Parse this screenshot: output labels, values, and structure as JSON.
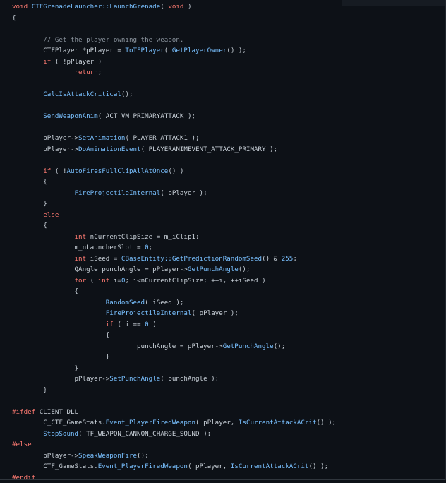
{
  "colors": {
    "background": "#0d1117",
    "keyword": "#ff7b72",
    "function": "#79c0ff",
    "comment": "#8b949e",
    "text": "#c9d1d9"
  },
  "code": {
    "language": "cpp",
    "lines": [
      [
        [
          "kw",
          "void"
        ],
        [
          "tx",
          " "
        ],
        [
          "fn",
          "CTFGrenadeLauncher::LaunchGrenade"
        ],
        [
          "tx",
          "( "
        ],
        [
          "kw",
          "void"
        ],
        [
          "tx",
          " )"
        ]
      ],
      [
        [
          "tx",
          "{"
        ]
      ],
      [],
      [
        [
          "tx",
          "\t"
        ],
        [
          "cm",
          "// Get the player owning the weapon."
        ]
      ],
      [
        [
          "tx",
          "\tCTFPlayer *pPlayer = "
        ],
        [
          "fn",
          "ToTFPlayer"
        ],
        [
          "tx",
          "( "
        ],
        [
          "fn",
          "GetPlayerOwner"
        ],
        [
          "tx",
          "() );"
        ]
      ],
      [
        [
          "tx",
          "\t"
        ],
        [
          "kw",
          "if"
        ],
        [
          "tx",
          " ( !pPlayer )"
        ]
      ],
      [
        [
          "tx",
          "\t\t"
        ],
        [
          "kw",
          "return"
        ],
        [
          "tx",
          ";"
        ]
      ],
      [],
      [
        [
          "tx",
          "\t"
        ],
        [
          "fn",
          "CalcIsAttackCritical"
        ],
        [
          "tx",
          "();"
        ]
      ],
      [],
      [
        [
          "tx",
          "\t"
        ],
        [
          "fn",
          "SendWeaponAnim"
        ],
        [
          "tx",
          "( ACT_VM_PRIMARYATTACK );"
        ]
      ],
      [],
      [
        [
          "tx",
          "\tpPlayer->"
        ],
        [
          "fn",
          "SetAnimation"
        ],
        [
          "tx",
          "( PLAYER_ATTACK1 );"
        ]
      ],
      [
        [
          "tx",
          "\tpPlayer->"
        ],
        [
          "fn",
          "DoAnimationEvent"
        ],
        [
          "tx",
          "( PLAYERANIMEVENT_ATTACK_PRIMARY );"
        ]
      ],
      [],
      [
        [
          "tx",
          "\t"
        ],
        [
          "kw",
          "if"
        ],
        [
          "tx",
          " ( !"
        ],
        [
          "fn",
          "AutoFiresFullClipAllAtOnce"
        ],
        [
          "tx",
          "() )"
        ]
      ],
      [
        [
          "tx",
          "\t{"
        ]
      ],
      [
        [
          "tx",
          "\t\t"
        ],
        [
          "fn",
          "FireProjectileInternal"
        ],
        [
          "tx",
          "( pPlayer );"
        ]
      ],
      [
        [
          "tx",
          "\t}"
        ]
      ],
      [
        [
          "tx",
          "\t"
        ],
        [
          "kw",
          "else"
        ]
      ],
      [
        [
          "tx",
          "\t{"
        ]
      ],
      [
        [
          "tx",
          "\t\t"
        ],
        [
          "kw",
          "int"
        ],
        [
          "tx",
          " nCurrentClipSize = m_iClip1;"
        ]
      ],
      [
        [
          "tx",
          "\t\tm_nLauncherSlot = "
        ],
        [
          "num",
          "0"
        ],
        [
          "tx",
          ";"
        ]
      ],
      [
        [
          "tx",
          "\t\t"
        ],
        [
          "kw",
          "int"
        ],
        [
          "tx",
          " iSeed = "
        ],
        [
          "fn",
          "CBaseEntity::GetPredictionRandomSeed"
        ],
        [
          "tx",
          "() & "
        ],
        [
          "num",
          "255"
        ],
        [
          "tx",
          ";"
        ]
      ],
      [
        [
          "tx",
          "\t\tQAngle punchAngle = pPlayer->"
        ],
        [
          "fn",
          "GetPunchAngle"
        ],
        [
          "tx",
          "();"
        ]
      ],
      [
        [
          "tx",
          "\t\t"
        ],
        [
          "kw",
          "for"
        ],
        [
          "tx",
          " ( "
        ],
        [
          "kw",
          "int"
        ],
        [
          "tx",
          " i="
        ],
        [
          "num",
          "0"
        ],
        [
          "tx",
          "; i<nCurrentClipSize; ++i, ++iSeed )"
        ]
      ],
      [
        [
          "tx",
          "\t\t{"
        ]
      ],
      [
        [
          "tx",
          "\t\t\t"
        ],
        [
          "fn",
          "RandomSeed"
        ],
        [
          "tx",
          "( iSeed );"
        ]
      ],
      [
        [
          "tx",
          "\t\t\t"
        ],
        [
          "fn",
          "FireProjectileInternal"
        ],
        [
          "tx",
          "( pPlayer );"
        ]
      ],
      [
        [
          "tx",
          "\t\t\t"
        ],
        [
          "kw",
          "if"
        ],
        [
          "tx",
          " ( i == "
        ],
        [
          "num",
          "0"
        ],
        [
          "tx",
          " )"
        ]
      ],
      [
        [
          "tx",
          "\t\t\t{"
        ]
      ],
      [
        [
          "tx",
          "\t\t\t\tpunchAngle = pPlayer->"
        ],
        [
          "fn",
          "GetPunchAngle"
        ],
        [
          "tx",
          "();"
        ]
      ],
      [
        [
          "tx",
          "\t\t\t}"
        ]
      ],
      [
        [
          "tx",
          "\t\t}"
        ]
      ],
      [
        [
          "tx",
          "\t\tpPlayer->"
        ],
        [
          "fn",
          "SetPunchAngle"
        ],
        [
          "tx",
          "( punchAngle );"
        ]
      ],
      [
        [
          "tx",
          "\t}"
        ]
      ],
      [],
      [
        [
          "pp",
          "#ifdef"
        ],
        [
          "tx",
          " CLIENT_DLL"
        ]
      ],
      [
        [
          "tx",
          "\tC_CTF_GameStats."
        ],
        [
          "fn",
          "Event_PlayerFiredWeapon"
        ],
        [
          "tx",
          "( pPlayer, "
        ],
        [
          "fn",
          "IsCurrentAttackACrit"
        ],
        [
          "tx",
          "() );"
        ]
      ],
      [
        [
          "tx",
          "\t"
        ],
        [
          "fn",
          "StopSound"
        ],
        [
          "tx",
          "( TF_WEAPON_CANNON_CHARGE_SOUND );"
        ]
      ],
      [
        [
          "pp",
          "#else"
        ]
      ],
      [
        [
          "tx",
          "\tpPlayer->"
        ],
        [
          "fn",
          "SpeakWeaponFire"
        ],
        [
          "tx",
          "();"
        ]
      ],
      [
        [
          "tx",
          "\tCTF_GameStats."
        ],
        [
          "fn",
          "Event_PlayerFiredWeapon"
        ],
        [
          "tx",
          "( pPlayer, "
        ],
        [
          "fn",
          "IsCurrentAttackACrit"
        ],
        [
          "tx",
          "() );"
        ]
      ],
      [
        [
          "pp",
          "#endif"
        ]
      ]
    ]
  }
}
